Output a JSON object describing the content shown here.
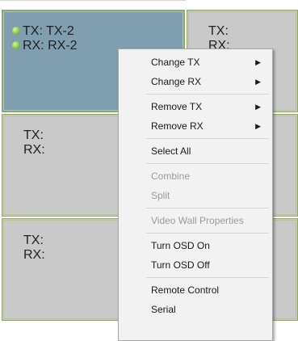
{
  "cells": [
    {
      "tx_label": "TX:",
      "tx_value": "TX-2",
      "rx_label": "RX:",
      "rx_value": "RX-2",
      "selected": true
    },
    {
      "tx_label": "TX:",
      "tx_value": "",
      "rx_label": "RX:",
      "rx_value": "",
      "selected": false
    },
    {
      "tx_label": "TX:",
      "tx_value": "",
      "rx_label": "RX:",
      "rx_value": "",
      "selected": false
    },
    {
      "tx_label": "TX:",
      "tx_value": "",
      "rx_label": "RX:",
      "rx_value": "",
      "selected": false
    }
  ],
  "menu": {
    "change_tx": "Change TX",
    "change_rx": "Change RX",
    "remove_tx": "Remove TX",
    "remove_rx": "Remove RX",
    "select_all": "Select All",
    "combine": "Combine",
    "split": "Split",
    "video_wall_properties": "Video Wall Properties",
    "turn_osd_on": "Turn OSD On",
    "turn_osd_off": "Turn OSD Off",
    "remote_control": "Remote Control",
    "serial": "Serial",
    "submenu_arrow": "▶"
  },
  "colors": {
    "selected_cell": "#7f9fb0",
    "cell": "#c9c9c9",
    "cell_border": "#b5c98a",
    "status_dot": "#7fc23c"
  }
}
